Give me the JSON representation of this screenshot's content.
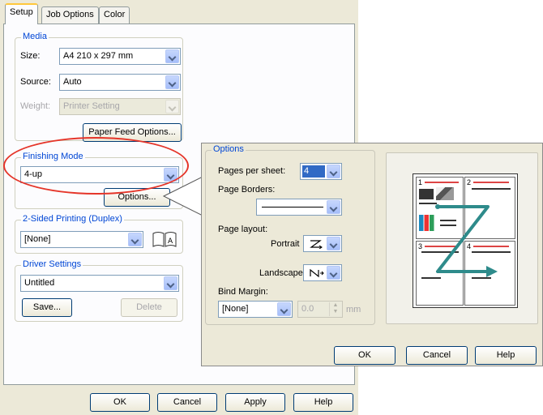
{
  "main_dialog": {
    "tabs": [
      {
        "label": "Setup",
        "active": true
      },
      {
        "label": "Job Options",
        "active": false
      },
      {
        "label": "Color",
        "active": false
      }
    ],
    "media": {
      "group_label": "Media",
      "size_label": "Size:",
      "size_value": "A4 210 x 297 mm",
      "source_label": "Source:",
      "source_value": "Auto",
      "weight_label": "Weight:",
      "weight_value": "Printer Setting",
      "paper_feed_button": "Paper Feed Options..."
    },
    "finishing": {
      "group_label": "Finishing Mode",
      "value": "4-up",
      "options_button": "Options..."
    },
    "duplex": {
      "group_label": "2-Sided Printing (Duplex)",
      "value": "[None]",
      "icon": "book-duplex-icon"
    },
    "driver": {
      "group_label": "Driver Settings",
      "value": "Untitled",
      "save_button": "Save...",
      "delete_button": "Delete"
    },
    "buttons": {
      "ok": "OK",
      "cancel": "Cancel",
      "apply": "Apply",
      "help": "Help"
    }
  },
  "options_dialog": {
    "group_label": "Options",
    "pages_per_sheet_label": "Pages per sheet:",
    "pages_per_sheet_value": "4",
    "page_borders_label": "Page Borders:",
    "page_layout_label": "Page layout:",
    "portrait_label": "Portrait",
    "portrait_icon": "z-order-icon",
    "landscape_label": "Landscape",
    "landscape_icon": "n-order-icon",
    "bind_margin_label": "Bind Margin:",
    "bind_margin_value": "[None]",
    "bind_margin_number": "0.0",
    "bind_margin_unit": "mm",
    "preview": {
      "page_numbers": [
        "1",
        "2",
        "3",
        "4"
      ]
    },
    "buttons": {
      "ok": "OK",
      "cancel": "Cancel",
      "help": "Help"
    }
  },
  "colors": {
    "group_label": "#0046d5",
    "highlight_ellipse": "#e53529",
    "preview_arrow": "#2e8b8b",
    "selection": "#316ac5"
  }
}
